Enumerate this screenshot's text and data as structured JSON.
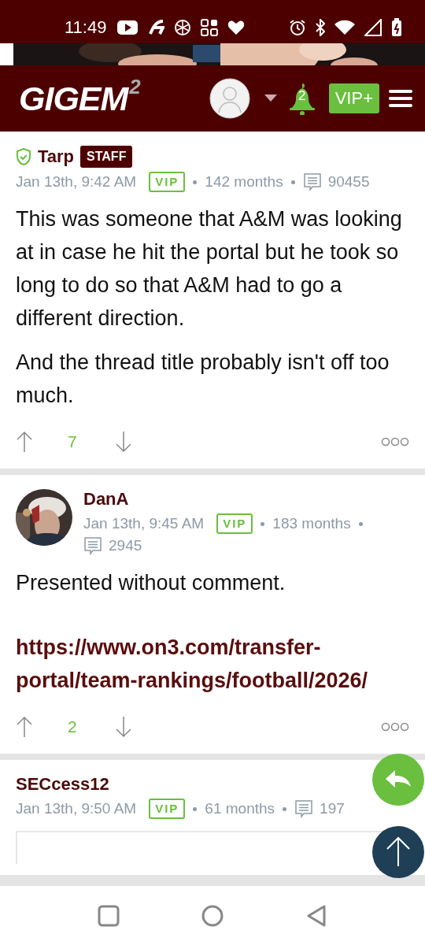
{
  "status_bar": {
    "time": "11:49"
  },
  "header": {
    "logo": "GIGEM",
    "logo_mark": "2",
    "notifications": "2",
    "vip_button": "VIP+"
  },
  "posts": [
    {
      "author": "Tarp",
      "kind": "staff",
      "badge": "STAFF",
      "date": "Jan 13th, 9:42 AM",
      "vip": "VIP",
      "tenure": "142 months",
      "post_count": "90455",
      "body": [
        {
          "kind": "text",
          "text": "This was someone that A&M was looking at in case he hit the portal but he took so long to do so that A&M had to go a different direction."
        },
        {
          "kind": "text",
          "text": "And the thread title probably isn't off too much."
        }
      ],
      "score": "7"
    },
    {
      "author": "DanA",
      "kind": "avatar",
      "date": "Jan 13th, 9:45 AM",
      "vip": "VIP",
      "tenure": "183 months",
      "post_count": "2945",
      "body": [
        {
          "kind": "text",
          "text": "Presented without comment."
        },
        {
          "kind": "link",
          "text": "https://www.on3.com/transfer-portal/team-rankings/football/2026/"
        }
      ],
      "score": "2"
    },
    {
      "author": "SECcess12",
      "kind": "plain",
      "date": "Jan 13th, 9:50 AM",
      "vip": "VIP",
      "tenure": "61 months",
      "post_count": "197",
      "quote": true
    }
  ]
}
